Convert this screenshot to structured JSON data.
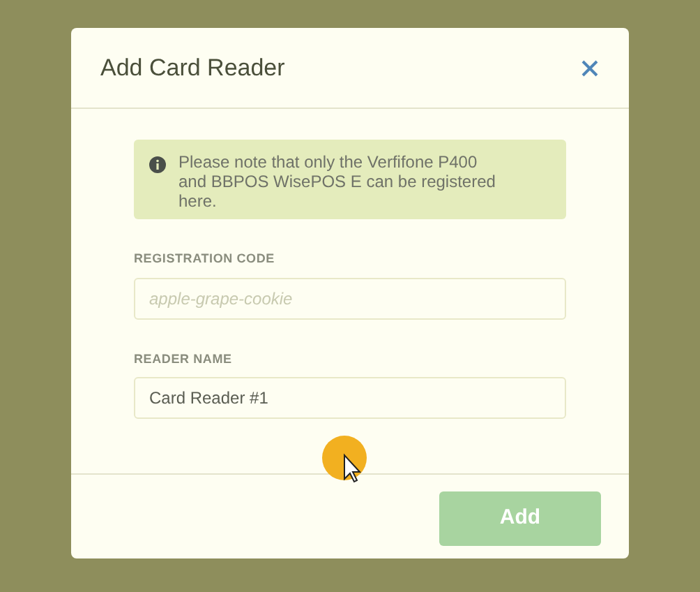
{
  "dialog": {
    "title": "Add Card Reader",
    "notice": "Please note that only the Verfifone P400 and BBPOS WisePOS E can be registered here.",
    "fields": [
      {
        "label": "REGISTRATION CODE",
        "placeholder": "apple-grape-cookie"
      },
      {
        "label": "READER NAME",
        "value": "Card Reader #1"
      }
    ],
    "button": {
      "label": "Add",
      "disabled": true
    }
  }
}
